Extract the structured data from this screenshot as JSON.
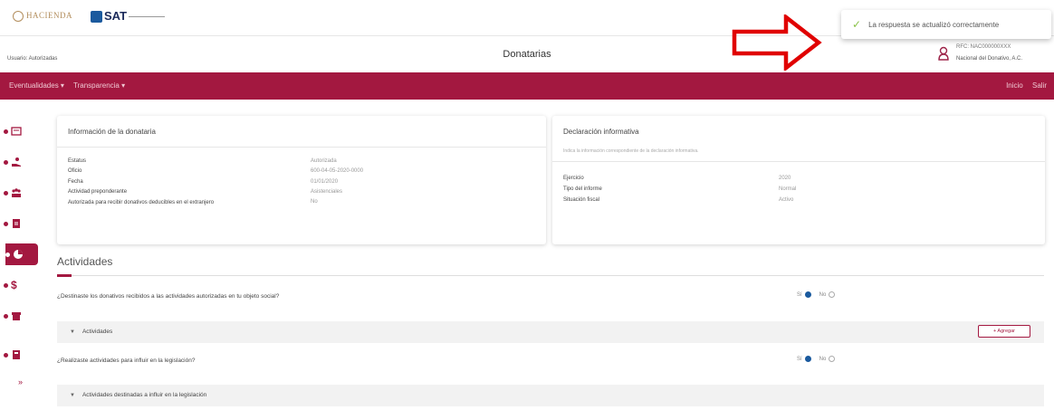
{
  "header": {
    "hacienda_logo": "HACIENDA",
    "sat_logo": "SAT"
  },
  "toast": {
    "message": "La respuesta se actualizó correctamente"
  },
  "subheader": {
    "breadcrumb": "Usuario: Autorizadas",
    "title": "Donatarias",
    "user_rfc": "RFC: NAC000000XXX",
    "user_name": "Nacional del Donativo, A.C."
  },
  "nav": {
    "menu": [
      "Eventualidades ▾",
      "Transparencia ▾"
    ],
    "right": [
      "Inicio",
      "Salir"
    ]
  },
  "sidebar": {
    "items": [
      "id-card-icon",
      "hand-money-icon",
      "group-icon",
      "document-icon",
      "pie-chart-icon",
      "dollar-icon",
      "box-icon",
      "book-icon"
    ],
    "collapse": "»"
  },
  "donataria_card": {
    "title": "Información de la donataria",
    "rows": [
      {
        "label": "Estatus",
        "value": "Autorizada"
      },
      {
        "label": "Oficio",
        "value": "600-04-05-2020-0000"
      },
      {
        "label": "Fecha",
        "value": "01/01/2020"
      },
      {
        "label": "Actividad preponderante",
        "value": "Asistenciales"
      },
      {
        "label": "Autorizada para recibir donativos deducibles en el extranjero",
        "value": "No"
      }
    ]
  },
  "declaracion_card": {
    "title": "Declaración informativa",
    "subtitle": "Indica la información correspondiente de la declaración informativa.",
    "rows": [
      {
        "label": "Ejercicio",
        "value": "2020"
      },
      {
        "label": "Tipo del informe",
        "value": "Normal"
      },
      {
        "label": "Situación fiscal",
        "value": "Activo"
      }
    ]
  },
  "actividades": {
    "title": "Actividades",
    "question1": "¿Destinaste los donativos recibidos a las actividades autorizadas en tu objeto social?",
    "question2": "¿Realizaste actividades para influir en la legislación?",
    "yes": "Sí",
    "no": "No",
    "accordion1": "Actividades",
    "accordion2": "Actividades destinadas a influir en la legislación",
    "add_button": "+ Agregar"
  },
  "colors": {
    "brand": "#a31840",
    "accent": "#1b5a9e",
    "arrow": "#e00000"
  }
}
